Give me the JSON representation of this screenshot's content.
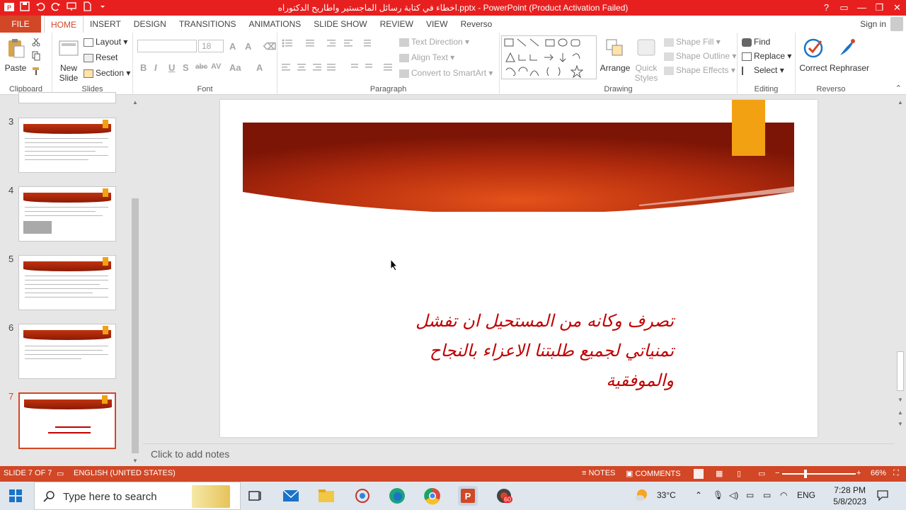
{
  "titlebar": {
    "title": "اخطاء في كتابة رسائل الماجستير واطاريح الدكتوراه.pptx - PowerPoint (Product Activation Failed)",
    "help": "?",
    "controls": [
      "▭",
      "—",
      "❐",
      "✕"
    ]
  },
  "tabs": {
    "file": "FILE",
    "items": [
      "HOME",
      "INSERT",
      "DESIGN",
      "TRANSITIONS",
      "ANIMATIONS",
      "SLIDE SHOW",
      "REVIEW",
      "VIEW",
      "Reverso"
    ],
    "active": "HOME",
    "signin": "Sign in"
  },
  "ribbon": {
    "clipboard": {
      "label": "Clipboard",
      "paste": "Paste"
    },
    "slides": {
      "label": "Slides",
      "new_slide_1": "New",
      "new_slide_2": "Slide",
      "layout": "Layout",
      "reset": "Reset",
      "section": "Section"
    },
    "font": {
      "label": "Font",
      "size": "18",
      "buttons": [
        "B",
        "I",
        "U",
        "S",
        "abc",
        "AV",
        "Aa",
        "A"
      ]
    },
    "paragraph": {
      "label": "Paragraph",
      "text_direction": "Text Direction",
      "align_text": "Align Text",
      "convert_smartart": "Convert to SmartArt"
    },
    "drawing": {
      "label": "Drawing",
      "arrange": "Arrange",
      "quick_styles_1": "Quick",
      "quick_styles_2": "Styles",
      "shape_fill": "Shape Fill",
      "shape_outline": "Shape Outline",
      "shape_effects": "Shape Effects"
    },
    "editing": {
      "label": "Editing",
      "find": "Find",
      "replace": "Replace",
      "select": "Select"
    },
    "reverso": {
      "label": "Reverso",
      "correct": "Correct",
      "rephraser": "Rephraser"
    }
  },
  "thumbnails": [
    {
      "num": "3"
    },
    {
      "num": "4"
    },
    {
      "num": "5"
    },
    {
      "num": "6"
    },
    {
      "num": "7",
      "active": true
    }
  ],
  "slide": {
    "line1": "تصرف وكانه من المستحيل ان تفشل",
    "line2": "تمنياتي لجميع طلبتنا الاعزاء بالنجاح والموفقية"
  },
  "notes": {
    "placeholder": "Click to add notes"
  },
  "status": {
    "slide_of": "SLIDE 7 OF 7",
    "language": "ENGLISH (UNITED STATES)",
    "notes": "NOTES",
    "comments": "COMMENTS",
    "zoom": "66%"
  },
  "taskbar": {
    "search_placeholder": "Type here to search",
    "temperature": "33°C",
    "lang": "ENG",
    "time": "7:28 PM",
    "date": "5/8/2023",
    "badge": "60"
  },
  "colors": {
    "accent": "#d24726",
    "titlebar": "#e81f1f",
    "slide_text": "#c00000",
    "gold": "#f2a112"
  }
}
